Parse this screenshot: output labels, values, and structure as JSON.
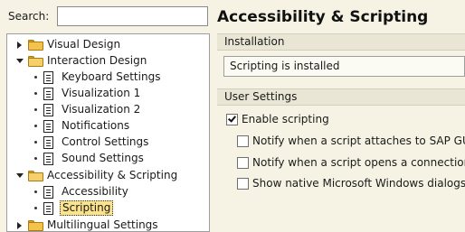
{
  "search": {
    "label": "Search:",
    "value": "",
    "placeholder": ""
  },
  "page_title": "Accessibility & Scripting",
  "tree": {
    "items": [
      {
        "label": "Visual Design",
        "type": "folder",
        "expanded": false
      },
      {
        "label": "Interaction Design",
        "type": "folder",
        "expanded": true
      },
      {
        "label": "Keyboard Settings",
        "type": "page"
      },
      {
        "label": "Visualization 1",
        "type": "page"
      },
      {
        "label": "Visualization 2",
        "type": "page"
      },
      {
        "label": "Notifications",
        "type": "page"
      },
      {
        "label": "Control Settings",
        "type": "page"
      },
      {
        "label": "Sound Settings",
        "type": "page"
      },
      {
        "label": "Accessibility & Scripting",
        "type": "folder",
        "expanded": true
      },
      {
        "label": "Accessibility",
        "type": "page"
      },
      {
        "label": "Scripting",
        "type": "page",
        "selected": true
      },
      {
        "label": "Multilingual Settings",
        "type": "folder",
        "expanded": false
      }
    ]
  },
  "installation": {
    "header": "Installation",
    "status": "Scripting is installed"
  },
  "user_settings": {
    "header": "User Settings",
    "options": [
      {
        "label": "Enable scripting",
        "checked": true
      },
      {
        "label": "Notify when a script attaches to SAP GUI",
        "checked": false
      },
      {
        "label": "Notify when a script opens a connection",
        "checked": false
      },
      {
        "label": "Show native Microsoft Windows dialogs",
        "checked": false
      }
    ]
  },
  "colors": {
    "background": "#f6f3e4",
    "selection": "#fbe38d",
    "folder": "#f2c24a"
  },
  "icons": {
    "folder": "folder-icon",
    "page": "document-icon",
    "expand": "triangle-right-icon",
    "collapse": "triangle-down-icon"
  }
}
